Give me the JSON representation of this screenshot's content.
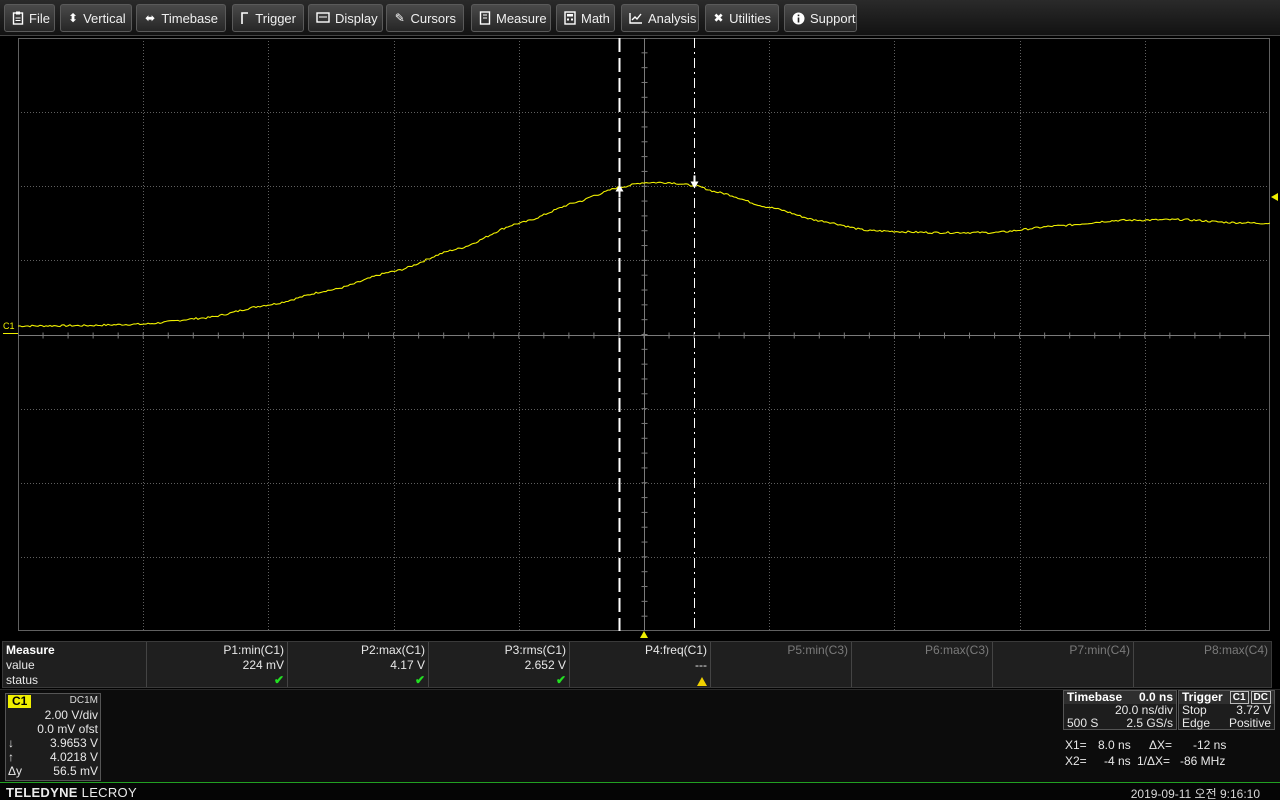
{
  "menu": [
    {
      "label": "File",
      "icon": "clipboard-icon"
    },
    {
      "label": "Vertical",
      "icon": "vertical-arrows-icon"
    },
    {
      "label": "Timebase",
      "icon": "horizontal-arrows-icon"
    },
    {
      "label": "Trigger",
      "icon": "trigger-flag-icon"
    },
    {
      "label": "Display",
      "icon": "display-icon"
    },
    {
      "label": "Cursors",
      "icon": "cursor-pen-icon"
    },
    {
      "label": "Measure",
      "icon": "measure-icon"
    },
    {
      "label": "Math",
      "icon": "calculator-icon"
    },
    {
      "label": "Analysis",
      "icon": "analysis-chart-icon"
    },
    {
      "label": "Utilities",
      "icon": "tools-icon"
    },
    {
      "label": "Support",
      "icon": "info-icon"
    }
  ],
  "colors": {
    "trace": "#f0f000",
    "grid": "#606060",
    "background": "#000000",
    "cursor": "#ffffff",
    "status_ok": "#22e022",
    "status_warn": "#f0d000"
  },
  "channel_marker": "C1",
  "waveform": {
    "channel": "C1",
    "x_unit": "ns",
    "y_unit": "V",
    "x_range": [
      -100,
      100
    ],
    "y_range": [
      -8,
      8
    ],
    "x_per_div": 20,
    "y_per_div": 2,
    "points": [
      [
        -100,
        0.23
      ],
      [
        -90,
        0.24
      ],
      [
        -80,
        0.28
      ],
      [
        -70,
        0.45
      ],
      [
        -60,
        0.8
      ],
      [
        -50,
        1.2
      ],
      [
        -40,
        1.7
      ],
      [
        -30,
        2.3
      ],
      [
        -20,
        3.0
      ],
      [
        -10,
        3.6
      ],
      [
        -8,
        3.75
      ],
      [
        -4,
        3.97
      ],
      [
        0,
        4.1
      ],
      [
        4,
        4.1
      ],
      [
        8,
        4.02
      ],
      [
        12,
        3.83
      ],
      [
        20,
        3.43
      ],
      [
        28,
        3.07
      ],
      [
        36,
        2.8
      ],
      [
        46,
        2.75
      ],
      [
        56,
        2.75
      ],
      [
        66,
        2.93
      ],
      [
        76,
        3.08
      ],
      [
        86,
        3.1
      ],
      [
        94,
        3.02
      ],
      [
        100,
        3.0
      ]
    ],
    "cursors": [
      {
        "name": "X1",
        "time": -4,
        "style": "dashed",
        "marker_value": 3.9653
      },
      {
        "name": "X2",
        "time": 8,
        "style": "dash-dot",
        "marker_value": 4.0218
      }
    ]
  },
  "measure": {
    "header": "Measure",
    "row_labels": [
      "value",
      "status"
    ],
    "params": [
      {
        "name": "P1:min(C1)",
        "value": "224 mV",
        "status": "ok",
        "active": true
      },
      {
        "name": "P2:max(C1)",
        "value": "4.17 V",
        "status": "ok",
        "active": true
      },
      {
        "name": "P3:rms(C1)",
        "value": "2.652 V",
        "status": "ok",
        "active": true
      },
      {
        "name": "P4:freq(C1)",
        "value": "---",
        "status": "warning",
        "active": true
      },
      {
        "name": "P5:min(C3)",
        "value": "",
        "status": "",
        "active": false
      },
      {
        "name": "P6:max(C3)",
        "value": "",
        "status": "",
        "active": false
      },
      {
        "name": "P7:min(C4)",
        "value": "",
        "status": "",
        "active": false
      },
      {
        "name": "P8:max(C4)",
        "value": "",
        "status": "",
        "active": false
      }
    ]
  },
  "channel": {
    "tag": "C1",
    "coupling": "DC1M",
    "vdiv": "2.00 V/div",
    "offset": "0.0 mV ofst",
    "cursor1_symbol": "↓",
    "cursor1_value": "3.9653 V",
    "cursor2_symbol": "↑",
    "cursor2_value": "4.0218 V",
    "delta_label": "Δy",
    "delta_value": "56.5 mV"
  },
  "timebase": {
    "header": "Timebase",
    "delay": "0.0 ns",
    "tdiv": "20.0 ns/div",
    "samples": "500 S",
    "rate": "2.5 GS/s"
  },
  "trigger": {
    "header": "Trigger",
    "source": "C1",
    "coupling": "DC",
    "mode": "Stop",
    "level": "3.72 V",
    "type": "Edge",
    "slope": "Positive"
  },
  "cursor_readout": {
    "x1_label": "X1=",
    "x1_value": "8.0 ns",
    "dx_label": "ΔX=",
    "dx_value": "-12 ns",
    "x2_label": "X2=",
    "x2_value": "-4 ns",
    "inv_dx_label": "1/ΔX=",
    "inv_dx_value": "-86 MHz"
  },
  "status": {
    "brand_bold": "TELEDYNE",
    "brand_light": "LECROY",
    "datetime": "2019-09-11 오전 9:16:10"
  }
}
